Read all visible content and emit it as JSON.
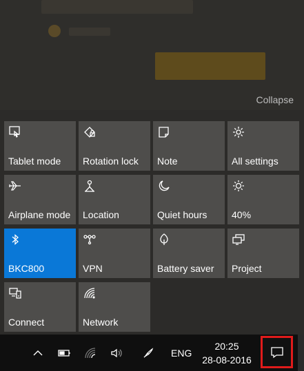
{
  "collapse_label": "Collapse",
  "tiles": [
    {
      "label": "Tablet mode",
      "icon": "tablet-mode-icon",
      "active": false
    },
    {
      "label": "Rotation lock",
      "icon": "rotation-lock-icon",
      "active": false
    },
    {
      "label": "Note",
      "icon": "note-icon",
      "active": false
    },
    {
      "label": "All settings",
      "icon": "gear-icon",
      "active": false
    },
    {
      "label": "Airplane mode",
      "icon": "airplane-icon",
      "active": false
    },
    {
      "label": "Location",
      "icon": "location-icon",
      "active": false
    },
    {
      "label": "Quiet hours",
      "icon": "moon-icon",
      "active": false
    },
    {
      "label": "40%",
      "icon": "brightness-icon",
      "active": false
    },
    {
      "label": "BKC800",
      "icon": "bluetooth-icon",
      "active": true
    },
    {
      "label": "VPN",
      "icon": "vpn-icon",
      "active": false
    },
    {
      "label": "Battery saver",
      "icon": "battery-saver-icon",
      "active": false
    },
    {
      "label": "Project",
      "icon": "project-icon",
      "active": false
    },
    {
      "label": "Connect",
      "icon": "connect-icon",
      "active": false
    },
    {
      "label": "Network",
      "icon": "network-icon",
      "active": false
    }
  ],
  "taskbar": {
    "language": "ENG",
    "time": "20:25",
    "date": "28-08-2016"
  },
  "colors": {
    "tile": "#4e4d4b",
    "tile_active": "#0a78d7",
    "highlight": "#e01b1b"
  }
}
